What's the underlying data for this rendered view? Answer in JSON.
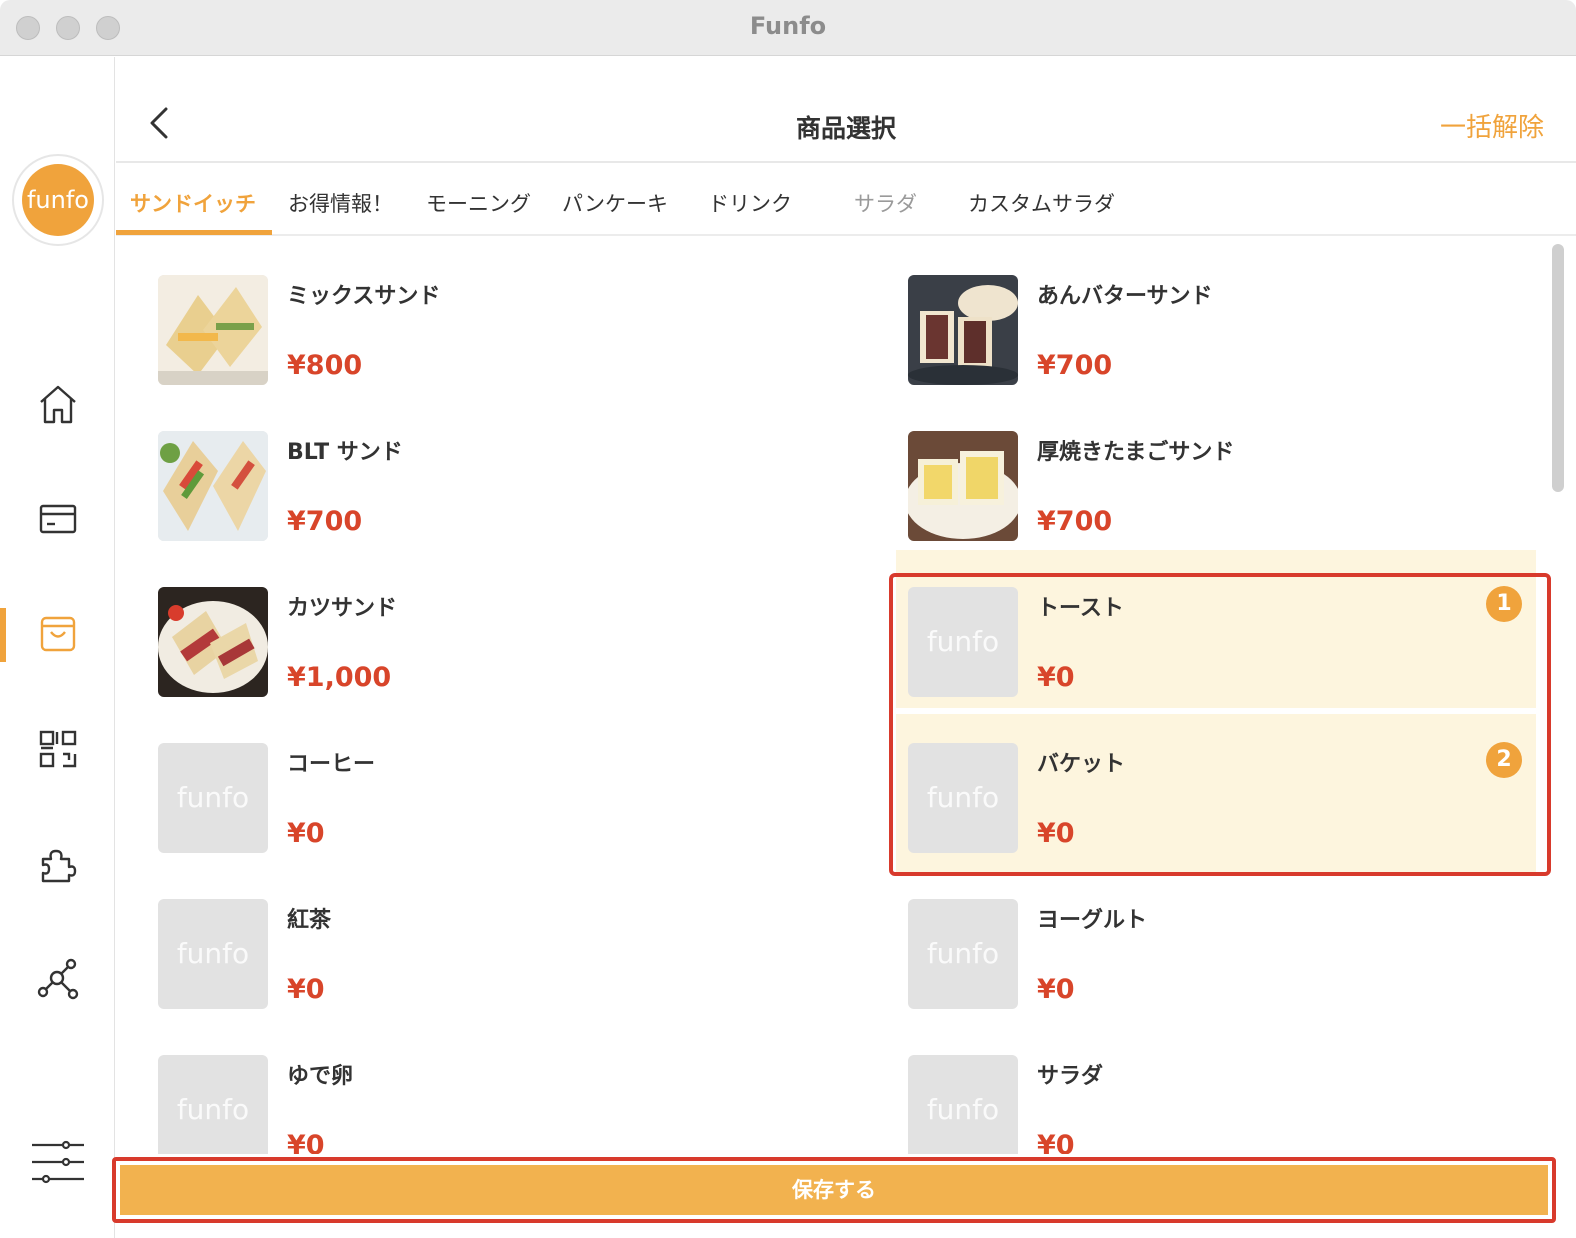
{
  "window": {
    "title": "Funfo"
  },
  "sidebar": {
    "logo_text": "funfo",
    "items": [
      {
        "icon": "home-icon"
      },
      {
        "icon": "card-icon"
      },
      {
        "icon": "shopping-bag-icon",
        "active": true
      },
      {
        "icon": "qr-code-icon"
      },
      {
        "icon": "puzzle-icon"
      },
      {
        "icon": "network-icon"
      },
      {
        "icon": "settings-sliders-icon"
      }
    ]
  },
  "header": {
    "back_icon": "chevron-left-icon",
    "title": "商品選択",
    "clear_all_label": "一括解除"
  },
  "tabs": [
    {
      "label": "サンドイッチ",
      "active": true
    },
    {
      "label": "お得情報！"
    },
    {
      "label": "モーニング"
    },
    {
      "label": "パンケーキ"
    },
    {
      "label": "ドリンク"
    },
    {
      "label": "サラダ",
      "muted": true
    },
    {
      "label": "カスタムサラダ"
    }
  ],
  "products": [
    {
      "name": "ミックスサンド",
      "price": "¥800"
    },
    {
      "name": "あんバターサンド",
      "price": "¥700"
    },
    {
      "name": "BLT サンド",
      "price": "¥700"
    },
    {
      "name": "厚焼きたまごサンド",
      "price": "¥700"
    },
    {
      "name": "カツサンド",
      "price": "¥1,000"
    },
    {
      "name": "トースト",
      "price": "¥0",
      "selected_order": "1"
    },
    {
      "name": "コーヒー",
      "price": "¥0"
    },
    {
      "name": "バケット",
      "price": "¥0",
      "selected_order": "2"
    },
    {
      "name": "紅茶",
      "price": "¥0"
    },
    {
      "name": "ヨーグルト",
      "price": "¥0"
    },
    {
      "name": "ゆで卵",
      "price": "¥0"
    },
    {
      "name": "サラダ",
      "price": "¥0"
    }
  ],
  "placeholder_logo_text": "funfo",
  "save_button": {
    "label": "保存する"
  },
  "colors": {
    "accent": "#f0a33c",
    "price": "#d8452a",
    "selected_bg": "#fdf5de",
    "annotation": "#d83a2c"
  }
}
